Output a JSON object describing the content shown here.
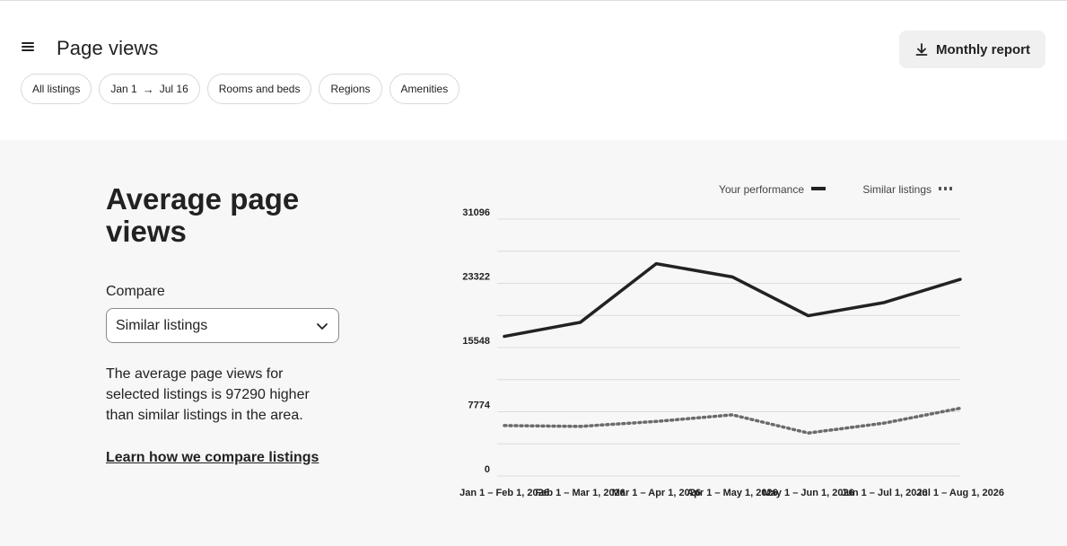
{
  "header": {
    "title": "Page views",
    "report_button": "Monthly report"
  },
  "filters": {
    "all_listings": "All listings",
    "date_from": "Jan 1",
    "date_to": "Jul 16",
    "rooms": "Rooms and beds",
    "regions": "Regions",
    "amenities": "Amenities"
  },
  "summary": {
    "title": "Average page views",
    "compare_label": "Compare",
    "compare_value": "Similar listings",
    "description": "The average page views for selected listings is 97290 higher than similar listings in the area.",
    "learn_link": "Learn how we compare listings"
  },
  "icons": {
    "menu": "menu-icon",
    "download": "download-icon",
    "arrow": "arrow-right-icon",
    "chevron": "chevron-down-icon"
  },
  "chart_data": {
    "type": "line",
    "legend": [
      "Your performance",
      "Similar listings"
    ],
    "x": [
      "Jan 1 – Feb 1, 2026",
      "Feb 1 – Mar 1, 2026",
      "Mar 1 – Apr 1, 2026",
      "Apr 1 – May 1, 2026",
      "May 1 – Jun 1, 2026",
      "Jun 1 – Jul 1, 2026",
      "Jul 1 – Aug 1, 2026"
    ],
    "yticks": [
      0,
      7774,
      15548,
      23322,
      31096
    ],
    "ylim": [
      0,
      31096
    ],
    "series": [
      {
        "name": "Your performance",
        "style": "solid",
        "color": "#222222",
        "values": [
          16900,
          18600,
          25700,
          24100,
          19400,
          21000,
          23800
        ]
      },
      {
        "name": "Similar listings",
        "style": "dotted",
        "color": "#6b6b6b",
        "values": [
          6100,
          6000,
          6600,
          7400,
          5200,
          6400,
          8200
        ]
      }
    ]
  }
}
